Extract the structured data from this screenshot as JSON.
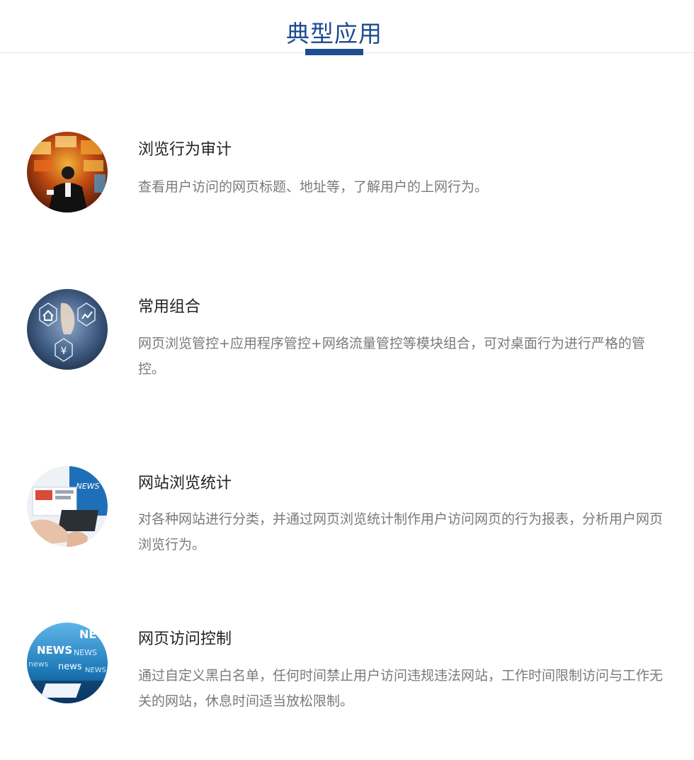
{
  "header": {
    "title": "典型应用",
    "accent_color": "#1d4c91"
  },
  "items": [
    {
      "title": "浏览行为审计",
      "description": "查看用户访问的网页标题、地址等，了解用户的上网行为。",
      "image": "businessman-screens-photo"
    },
    {
      "title": "常用组合",
      "description": "网页浏览管控+应用程序管控+网络流量管控等模块组合，可对桌面行为进行严格的管控。",
      "image": "hand-touch-icons-photo"
    },
    {
      "title": "网站浏览统计",
      "description": "对各种网站进行分类，并通过网页浏览统计制作用户访问网页的行为报表，分析用户网页浏览行为。",
      "image": "laptop-news-photo"
    },
    {
      "title": "网页访问控制",
      "description": "通过自定义黑白名单，任何时间禁止用户访问违规违法网站，工作时间限制访问与工作无关的网站，休息时间适当放松限制。",
      "image": "news-wall-photo"
    }
  ]
}
